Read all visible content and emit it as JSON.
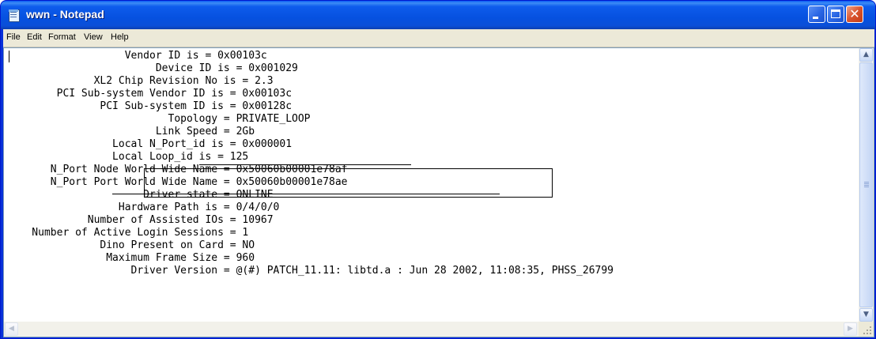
{
  "window": {
    "title": "wwn - Notepad",
    "close_symbol": "✕"
  },
  "menu": {
    "items": [
      "File",
      "Edit",
      "Format",
      "View",
      "Help"
    ]
  },
  "document": {
    "text": "                   Vendor ID is = 0x00103c\n                        Device ID is = 0x001029\n              XL2 Chip Revision No is = 2.3\n        PCI Sub-system Vendor ID is = 0x00103c\n               PCI Sub-system ID is = 0x00128c\n                          Topology = PRIVATE_LOOP\n                        Link Speed = 2Gb\n                 Local N_Port_id is = 0x000001\n                 Local Loop_id is = 125\n       N_Port Node World Wide Name = 0x50060b00001e78af\n       N_Port Port World Wide Name = 0x50060b00001e78ae\n                      Driver state = ONLINE\n                  Hardware Path is = 0/4/0/0\n             Number of Assisted IOs = 10967\n    Number of Active Login Sessions = 1\n               Dino Present on Card = NO\n                Maximum Frame Size = 960\n                    Driver Version = @(#) PATCH_11.11: libtd.a : Jun 28 2002, 11:08:35, PHSS_26799"
  },
  "scrollbars": {
    "up_arrow": "▲",
    "down_arrow": "▼",
    "left_arrow": "◀",
    "right_arrow": "▶"
  },
  "colors": {
    "titlebar": "#0a4fd8",
    "menubar": "#ece9d8",
    "editor_bg": "#ffffff"
  }
}
